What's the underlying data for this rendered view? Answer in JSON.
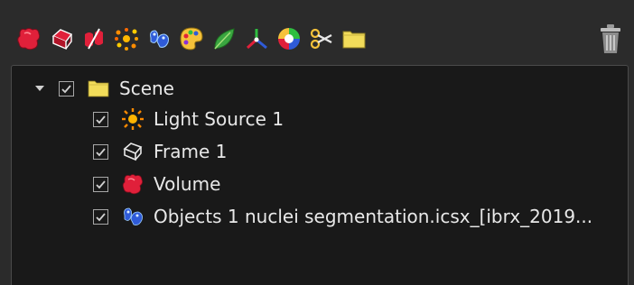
{
  "toolbar": {
    "tools": [
      {
        "name": "volume-tool-icon"
      },
      {
        "name": "frame-tool-icon"
      },
      {
        "name": "clipping-plane-tool-icon"
      },
      {
        "name": "spots-tool-icon"
      },
      {
        "name": "objects-tool-icon"
      },
      {
        "name": "color-palette-tool-icon"
      },
      {
        "name": "leaf-tool-icon"
      },
      {
        "name": "axes-tool-icon"
      },
      {
        "name": "color-wheel-tool-icon"
      },
      {
        "name": "scissors-tool-icon"
      },
      {
        "name": "folder-tool-icon"
      }
    ],
    "trash_icon": "trash-icon"
  },
  "scene_tree": {
    "root": {
      "label": "Scene",
      "checked": true,
      "expanded": true,
      "icon": "folder-icon"
    },
    "items": [
      {
        "label": "Light Source 1",
        "checked": true,
        "icon": "light-source-icon"
      },
      {
        "label": "Frame 1",
        "checked": true,
        "icon": "frame-icon"
      },
      {
        "label": "Volume",
        "checked": true,
        "icon": "volume-icon"
      },
      {
        "label": "Objects 1 nuclei segmentation.icsx_[ibrx_2019...",
        "checked": true,
        "icon": "objects-icon"
      }
    ]
  },
  "colors": {
    "background": "#2b2b2b",
    "tree_background": "#191919",
    "text": "#e8e8e8",
    "folder": "#f2dc5a",
    "volume": "#e0203a",
    "objects": "#2f5bd8"
  }
}
